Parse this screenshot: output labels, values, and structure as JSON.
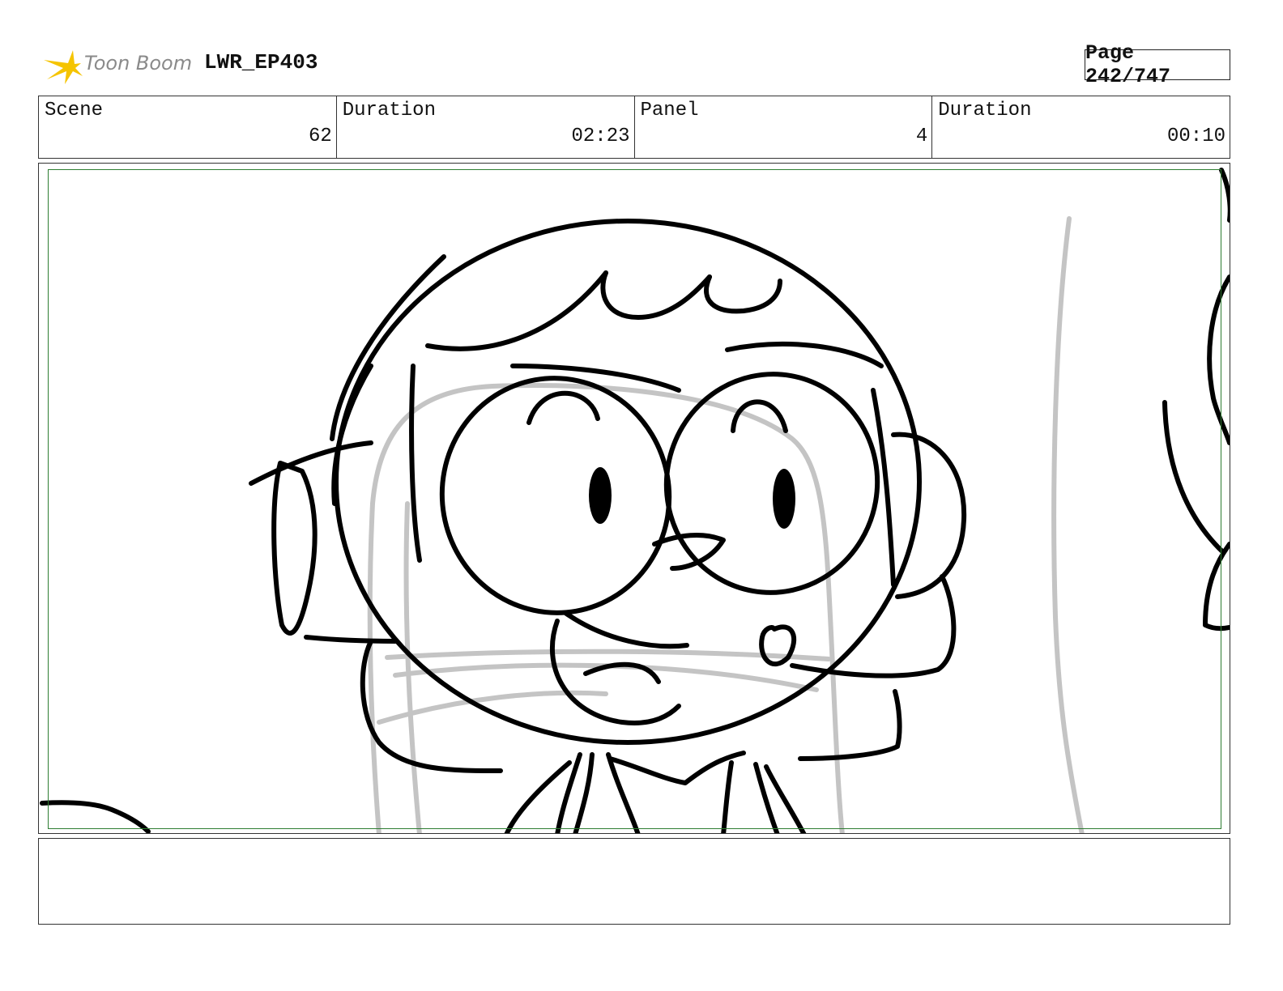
{
  "header": {
    "logo_text": "Toon Boom",
    "project": "LWR_EP403",
    "page": "Page 242/747"
  },
  "info": {
    "scene_label": "Scene",
    "scene_value": "62",
    "scene_duration_label": "Duration",
    "scene_duration_value": "02:23",
    "panel_label": "Panel",
    "panel_value": "4",
    "panel_duration_label": "Duration",
    "panel_duration_value": "00:10"
  },
  "colors": {
    "logo_star": "#f5c400",
    "safe_frame": "#2e7d32",
    "sketch_line": "#000000",
    "rough_line": "#c4c4c4"
  },
  "notes": {
    "text": ""
  }
}
